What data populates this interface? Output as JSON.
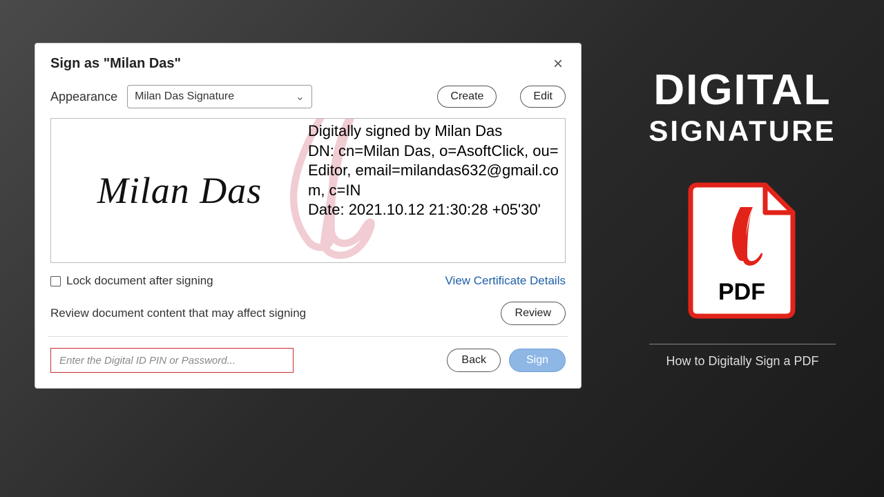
{
  "dialog": {
    "title": "Sign as \"Milan Das\"",
    "appearance_label": "Appearance",
    "appearance_value": "Milan Das Signature",
    "create_btn": "Create",
    "edit_btn": "Edit",
    "signature_name": "Milan Das",
    "sig_details": "Digitally signed by Milan Das\nDN: cn=Milan Das, o=AsoftClick, ou=Editor, email=milandas632@gmail.com, c=IN\nDate: 2021.10.12 21:30:28 +05'30'",
    "lock_label": "Lock document after signing",
    "cert_link": "View Certificate Details",
    "review_text": "Review document content that may affect signing",
    "review_btn": "Review",
    "pin_placeholder": "Enter the Digital ID PIN or Password...",
    "back_btn": "Back",
    "sign_btn": "Sign"
  },
  "promo": {
    "h1": "DIGITAL",
    "h2": "SIGNATURE",
    "pdf_label": "PDF",
    "tagline": "How to Digitally Sign a PDF"
  }
}
